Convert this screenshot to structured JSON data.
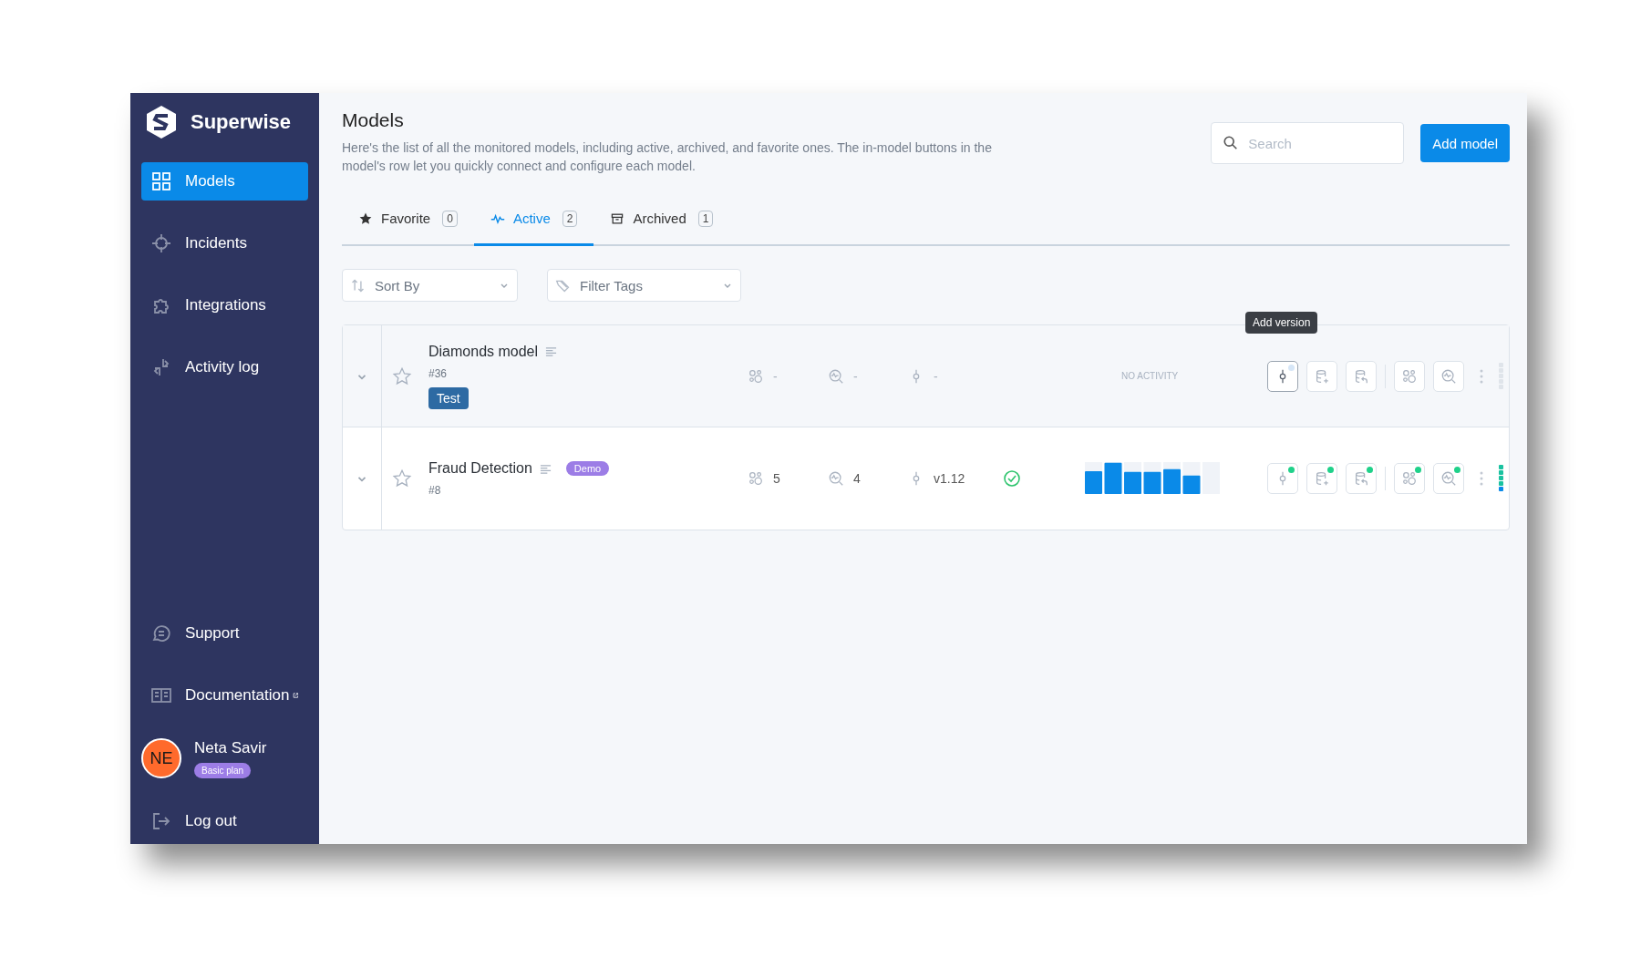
{
  "sidebar": {
    "brand": "Superwise",
    "items": [
      {
        "label": "Models",
        "selected": true
      },
      {
        "label": "Incidents",
        "selected": false
      },
      {
        "label": "Integrations",
        "selected": false
      },
      {
        "label": "Activity log",
        "selected": false
      }
    ],
    "bottom_items": [
      {
        "label": "Support",
        "external": false
      },
      {
        "label": "Documentation",
        "external": true
      }
    ],
    "user": {
      "initials": "NE",
      "name": "Neta Savir",
      "plan": "Basic plan"
    },
    "logout": "Log out"
  },
  "header": {
    "title": "Models",
    "description": "Here's the list of all the monitored models, including active, archived, and favorite ones. The in-model buttons in the model's row let you quickly connect and configure each model.",
    "search": {
      "placeholder": "Search"
    },
    "add_button": "Add model"
  },
  "tabs": [
    {
      "label": "Favorite",
      "count": "0",
      "selected": false
    },
    {
      "label": "Active",
      "count": "2",
      "selected": true
    },
    {
      "label": "Archived",
      "count": "1",
      "selected": false
    }
  ],
  "filters": [
    {
      "kind": "sort",
      "placeholder": "Sort By"
    },
    {
      "kind": "tags",
      "placeholder": "Filter Tags"
    }
  ],
  "tooltip": "Add version",
  "rows": [
    {
      "name": "Diamonds model",
      "id": "#36",
      "tag": {
        "label": "Test",
        "kind": "block",
        "color": "#2d6aa3"
      },
      "favorite": false,
      "shaded": true,
      "metrics": [
        "-",
        "-",
        "-"
      ],
      "validated": false,
      "activity": {
        "kind": "none",
        "label": "NO ACTIVITY"
      },
      "actions": [
        {
          "connected": false,
          "focused": true
        },
        {
          "connected": false,
          "focused": false
        },
        {
          "connected": false,
          "focused": false
        },
        {
          "connected": false,
          "focused": false
        },
        {
          "connected": false,
          "focused": false
        }
      ],
      "healthy": false
    },
    {
      "name": "Fraud Detection",
      "id": "#8",
      "tag": {
        "label": "Demo",
        "kind": "pill",
        "color": "#9c7de6"
      },
      "favorite": false,
      "shaded": false,
      "metrics": [
        "5",
        "4",
        "v1.12"
      ],
      "validated": true,
      "activity": {
        "kind": "bars"
      },
      "actions": [
        {
          "connected": true,
          "focused": false
        },
        {
          "connected": true,
          "focused": false
        },
        {
          "connected": true,
          "focused": false
        },
        {
          "connected": true,
          "focused": false
        },
        {
          "connected": true,
          "focused": false
        }
      ],
      "healthy": true
    }
  ]
}
